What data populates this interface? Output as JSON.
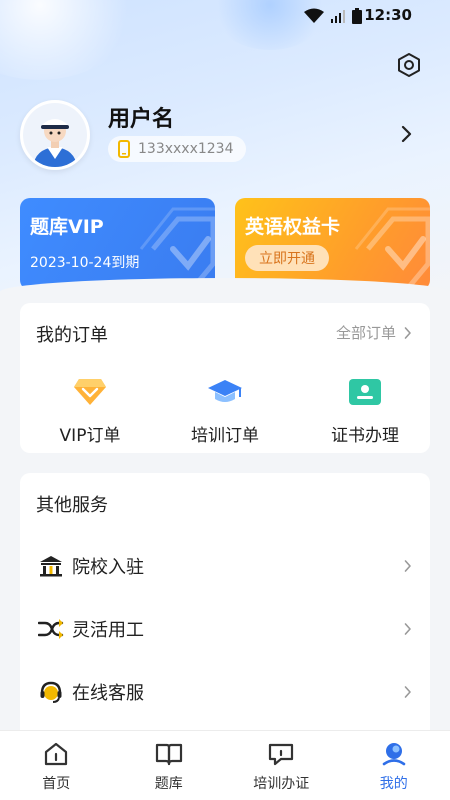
{
  "status_bar": {
    "time": "12:30"
  },
  "profile": {
    "username": "用户名",
    "phone": "133xxxx1234"
  },
  "cards": {
    "vip": {
      "title": "题库VIP",
      "expiry": "2023-10-24到期"
    },
    "english": {
      "title": "英语权益卡",
      "button_label": "立即开通"
    }
  },
  "orders": {
    "title": "我的订单",
    "all_link": "全部订单",
    "items": [
      {
        "label": "VIP订单",
        "icon": "vip-diamond-icon"
      },
      {
        "label": "培训订单",
        "icon": "graduation-cap-icon"
      },
      {
        "label": "证书办理",
        "icon": "certificate-icon"
      }
    ]
  },
  "services": {
    "title": "其他服务",
    "items": [
      {
        "label": "院校入驻",
        "icon": "school-building-icon"
      },
      {
        "label": "灵活用工",
        "icon": "shuffle-icon"
      },
      {
        "label": "在线客服",
        "icon": "headset-icon"
      }
    ]
  },
  "bottom_nav": {
    "items": [
      {
        "label": "首页",
        "icon": "home-icon"
      },
      {
        "label": "题库",
        "icon": "book-icon"
      },
      {
        "label": "培训办证",
        "icon": "chat-icon"
      },
      {
        "label": "我的",
        "icon": "profile-icon"
      }
    ],
    "active_index": 3
  },
  "colors": {
    "accent": "#2f6fe8",
    "vip_card": "#3a7cf0",
    "english_card": "#ffa62a"
  }
}
